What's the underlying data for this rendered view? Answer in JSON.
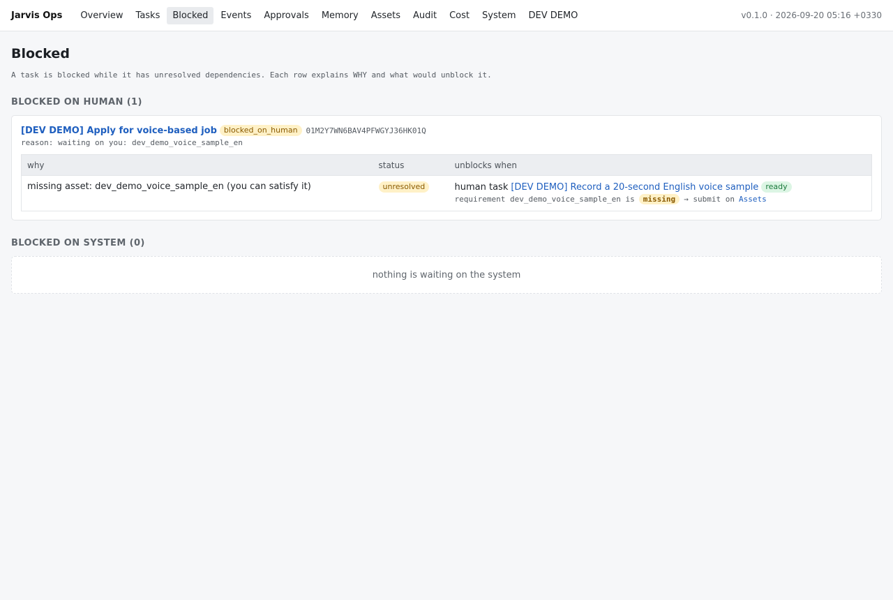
{
  "app": {
    "brand": "Jarvis Ops",
    "version": "v0.1.0 · 2026-09-20 05:16 +0330"
  },
  "nav": {
    "items": [
      {
        "label": "Overview"
      },
      {
        "label": "Tasks"
      },
      {
        "label": "Blocked",
        "active": true
      },
      {
        "label": "Events"
      },
      {
        "label": "Approvals"
      },
      {
        "label": "Memory"
      },
      {
        "label": "Assets"
      },
      {
        "label": "Audit"
      },
      {
        "label": "Cost"
      },
      {
        "label": "System"
      },
      {
        "label": "DEV DEMO"
      }
    ]
  },
  "page": {
    "title": "Blocked",
    "intro": "A task is blocked while it has unresolved dependencies. Each row explains WHY and what would unblock it."
  },
  "blocked_on_human": {
    "heading": "BLOCKED ON HUMAN (1)",
    "task": {
      "title": "[DEV DEMO] Apply for voice-based job",
      "state": "blocked_on_human",
      "id": "01M2Y7WN6BAV4PFWGYJ36HK01Q",
      "reason": "reason: waiting on you: dev_demo_voice_sample_en"
    },
    "table": {
      "headers": {
        "why": "why",
        "status": "status",
        "unblocks": "unblocks when"
      },
      "rows": [
        {
          "why": "missing asset: dev_demo_voice_sample_en (you can satisfy it)",
          "status": "unresolved",
          "unblock_prefix": "human task",
          "unblock_link": "[DEV DEMO] Record a 20-second English voice sample",
          "unblock_badge": "ready",
          "req_prefix": "requirement dev_demo_voice_sample_en is",
          "req_state": "missing",
          "req_arrow": "→ submit on",
          "req_link": "Assets"
        }
      ]
    }
  },
  "blocked_on_system": {
    "heading": "BLOCKED ON SYSTEM (0)",
    "empty_text": "nothing is waiting on the system"
  },
  "colors": {
    "link": "#1f5fbf",
    "badge_yellow_bg": "#fff1c7",
    "badge_green_bg": "#dcf5e4",
    "page_bg": "#f6f7f9"
  }
}
